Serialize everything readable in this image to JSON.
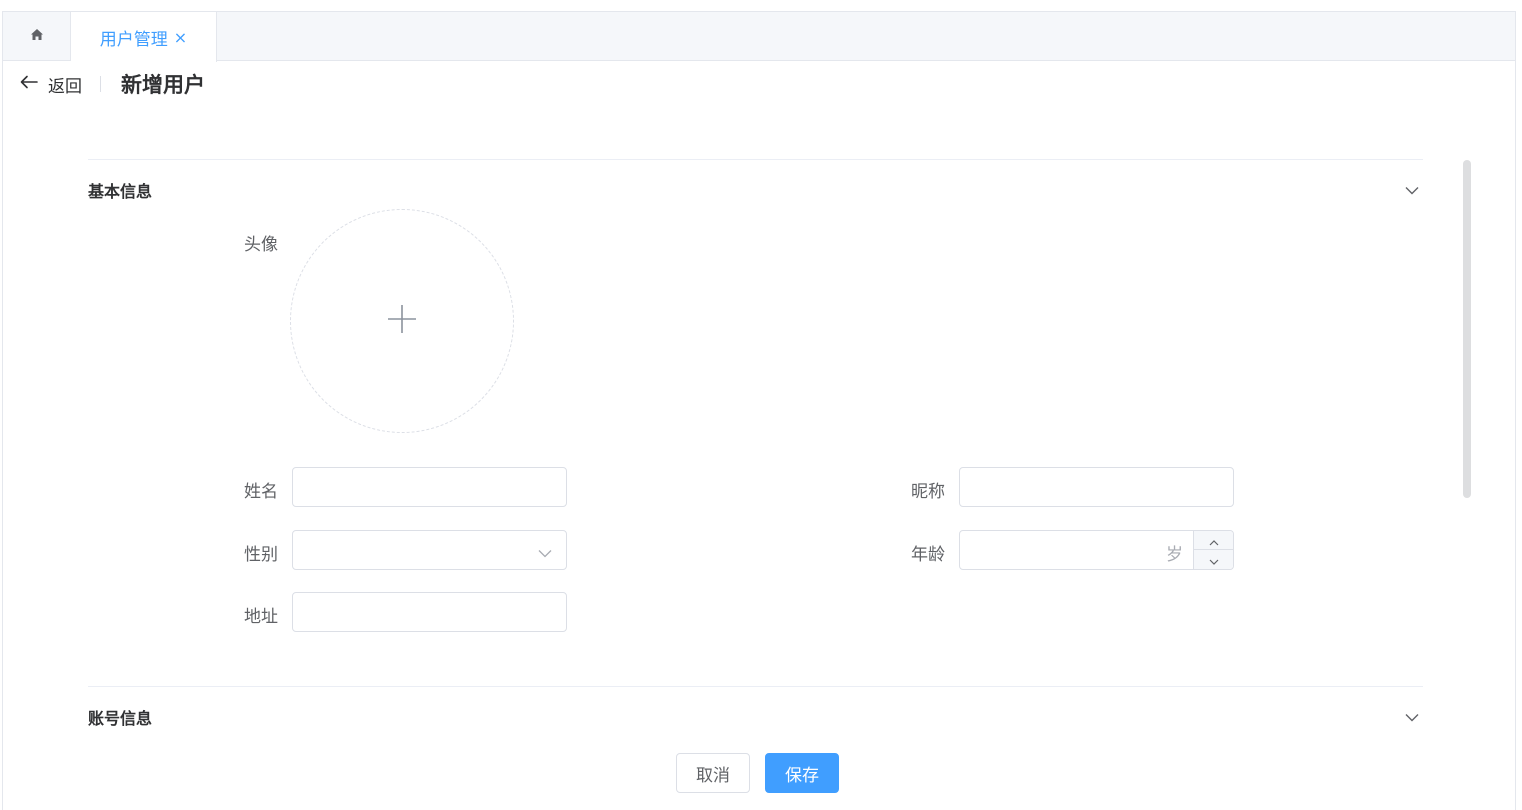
{
  "tabs": {
    "home_icon": "home-icon",
    "active_label": "用户管理",
    "close_glyph": "×"
  },
  "header": {
    "back_label": "返回",
    "title": "新增用户"
  },
  "sections": {
    "basic": {
      "title": "基本信息"
    },
    "account": {
      "title": "账号信息"
    }
  },
  "form": {
    "avatar_label": "头像",
    "name_label": "姓名",
    "name_value": "",
    "nickname_label": "昵称",
    "nickname_value": "",
    "gender_label": "性别",
    "gender_value": "",
    "age_label": "年龄",
    "age_value": "",
    "age_suffix": "岁",
    "address_label": "地址",
    "address_value": ""
  },
  "footer": {
    "cancel_label": "取消",
    "save_label": "保存"
  },
  "colors": {
    "accent": "#409eff",
    "border": "#dcdfe6",
    "text": "#303133"
  }
}
